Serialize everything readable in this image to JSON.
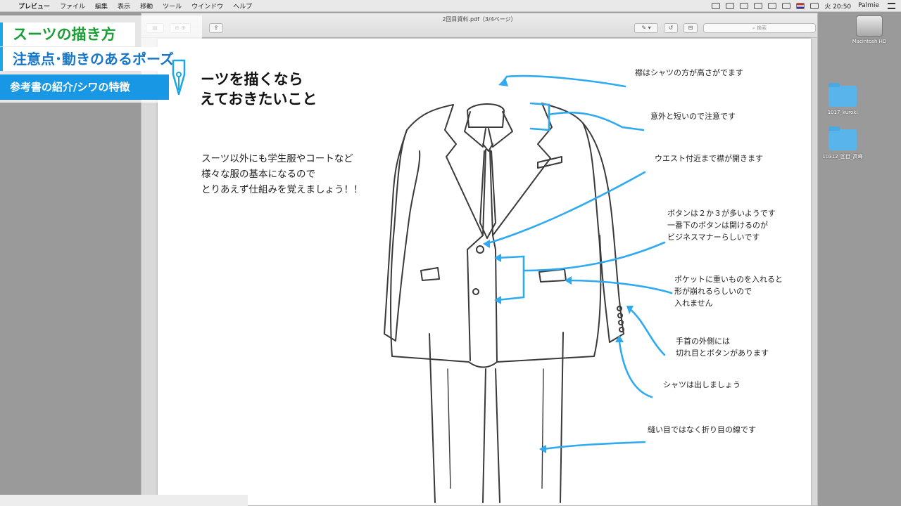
{
  "menubar": {
    "apple": "",
    "items": [
      "プレビュー",
      "ファイル",
      "編集",
      "表示",
      "移動",
      "ツール",
      "ウインドウ",
      "ヘルプ"
    ],
    "clock": "火 20:50",
    "user": "Palmie"
  },
  "desktop": {
    "drive_label": "Macintosh HD",
    "folders": [
      "1017_kuroki",
      "10312_回目_高峰"
    ]
  },
  "window": {
    "document_title": "2回目資料.pdf（3/4ページ）",
    "search_placeholder": "検索"
  },
  "overlay": {
    "line1": "スーツの描き方",
    "line2": "注意点･動きのあるポーズ",
    "line3": "参考書の紹介/シワの特徴"
  },
  "page": {
    "heading_line1": "ーツを描くなら",
    "heading_line2": "えておきたいこと",
    "body_lines": [
      "スーツ以外にも学生服やコートなど",
      "様々な服の基本になるので",
      "とりあえず仕組みを覚えましょう！！"
    ],
    "annotations": [
      {
        "id": "collar",
        "lines": [
          "襟はシャツの方が高さがでます"
        ]
      },
      {
        "id": "short",
        "lines": [
          "意外と短いので注意です"
        ]
      },
      {
        "id": "waist",
        "lines": [
          "ウエスト付近まで襟が開きます"
        ]
      },
      {
        "id": "buttons",
        "lines": [
          "ボタンは２か３が多いようです",
          "一番下のボタンは開けるのが",
          "ビジネスマナーらしいです"
        ]
      },
      {
        "id": "pocket",
        "lines": [
          "ポケットに重いものを入れると",
          "形が崩れるらしいので",
          "入れません"
        ]
      },
      {
        "id": "cuff",
        "lines": [
          "手首の外側には",
          "切れ目とボタンがあります"
        ]
      },
      {
        "id": "shirt",
        "lines": [
          "シャツは出しましょう"
        ]
      },
      {
        "id": "seam",
        "lines": [
          "縫い目ではなく折り目の線です"
        ]
      }
    ],
    "arrow_color": "#2eaaf0"
  }
}
